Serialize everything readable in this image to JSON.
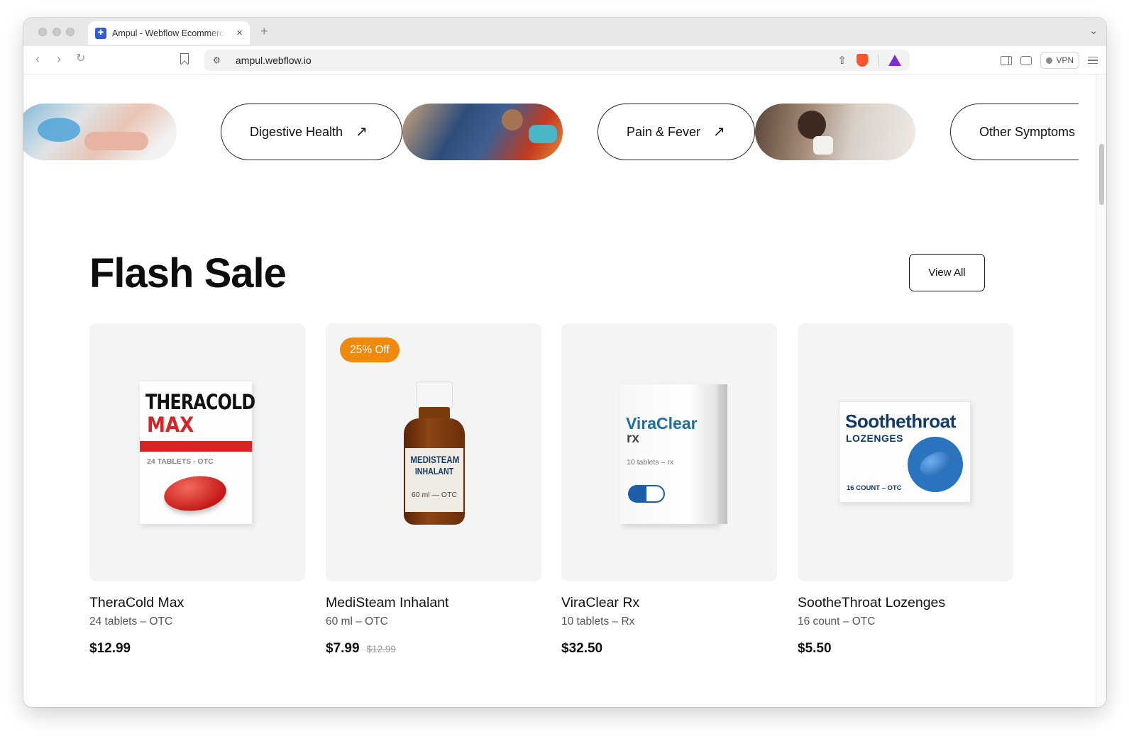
{
  "browser": {
    "tab_title": "Ampul - Webflow Ecommerce",
    "tab_close": "×",
    "new_tab": "+",
    "url": "ampul.webflow.io",
    "vpn_label": "VPN"
  },
  "categories": [
    {
      "label": "Digestive Health",
      "arrow": "↗"
    },
    {
      "label": "Pain & Fever",
      "arrow": "↗"
    },
    {
      "label": "Other Symptoms",
      "arrow": "↗"
    }
  ],
  "flash_sale": {
    "title": "Flash Sale",
    "view_all": "View All"
  },
  "products": [
    {
      "name": "TheraCold Max",
      "pack": "24 tablets – OTC",
      "price": "$12.99",
      "box": {
        "line1": "THERACOLD",
        "line2": "MAX",
        "sub": "24 TABLETS - OTC"
      }
    },
    {
      "name": "MediSteam Inhalant",
      "pack": "60 ml – OTC",
      "price": "$7.99",
      "old_price": "$12.99",
      "badge": "25% Off",
      "box": {
        "line1": "MEDISTEAM",
        "line2": "INHALANT",
        "sub": "60 ml — OTC"
      }
    },
    {
      "name": "ViraClear Rx",
      "pack": "10 tablets – Rx",
      "price": "$32.50",
      "box": {
        "line1": "ViraClear",
        "line2": "rx",
        "sub": "10 tablets – rx"
      }
    },
    {
      "name": "SootheThroat Lozenges",
      "pack": "16 count – OTC",
      "price": "$5.50",
      "box": {
        "line1": "Soothethroat",
        "line2": "LOZENGES",
        "sub": "16 COUNT – OTC"
      }
    }
  ],
  "colors": {
    "badge": "#ef8a10",
    "accent_red": "#d42626",
    "card_bg": "#f4f4f4"
  }
}
